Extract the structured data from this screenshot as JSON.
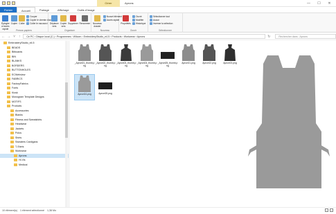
{
  "window": {
    "context_tab": "Gérer",
    "title": "Aprons",
    "minimize": "—",
    "maximize": "☐",
    "close": "✕"
  },
  "tabs": [
    "Fichier",
    "Accueil",
    "Partage",
    "Affichage",
    "Outils d'image"
  ],
  "ribbon": {
    "groups": [
      {
        "name": "Presse-papiers",
        "big": [
          "Épingler à Accès rapide",
          "Copier",
          "Coller"
        ],
        "small": [
          "Couper",
          "Copier le chemin d'accès",
          "Coller le raccourci"
        ]
      },
      {
        "name": "Organiser",
        "big": [
          "Déplacer vers",
          "Copier vers",
          "Supprimer",
          "Renommer"
        ],
        "small": []
      },
      {
        "name": "Nouveau",
        "big": [
          "Nouveau dossier"
        ],
        "small": [
          "Nouvel élément",
          "Accès rapide"
        ]
      },
      {
        "name": "Ouvrir",
        "big": [
          "Propriétés"
        ],
        "small": [
          "Ouvrir",
          "Modifier",
          "Historique"
        ]
      },
      {
        "name": "Sélectionner",
        "big": [],
        "small": [
          "Sélectionner tout",
          "Aucun",
          "Inverser la sélection"
        ]
      }
    ]
  },
  "address": {
    "path": "Ce PC  ›  Disque local (C:)  ›  Programmes  ›  Wilcom  ›  EmbroideryStudio_e4.5  ›  Products  ›  Workwear  ›  Aprons",
    "search_placeholder": "Rechercher dans : Aprons"
  },
  "sidebar": {
    "items": [
      {
        "label": "EmbroideryStudio_e4.5",
        "indent": 1
      },
      {
        "label": "BEADS",
        "indent": 2
      },
      {
        "label": "Bitboards",
        "indent": 2
      },
      {
        "label": "BIN",
        "indent": 2
      },
      {
        "label": "BLANKS",
        "indent": 2
      },
      {
        "label": "BORDERS",
        "indent": 2
      },
      {
        "label": "BUTTONHOLES",
        "indent": 2
      },
      {
        "label": "ECWebview",
        "indent": 2
      },
      {
        "label": "FABRICS",
        "indent": 2
      },
      {
        "label": "FactoryFabrics",
        "indent": 2
      },
      {
        "label": "Fonts",
        "indent": 2
      },
      {
        "label": "Kiosk",
        "indent": 2
      },
      {
        "label": "Monogram Template Designs",
        "indent": 2
      },
      {
        "label": "MOTIFS",
        "indent": 2
      },
      {
        "label": "Products",
        "indent": 2
      },
      {
        "label": "Accessories",
        "indent": 3
      },
      {
        "label": "Blanks",
        "indent": 3
      },
      {
        "label": "Fitness and Sweatshirts",
        "indent": 3
      },
      {
        "label": "Headwear",
        "indent": 3
      },
      {
        "label": "Jackets",
        "indent": 3
      },
      {
        "label": "Polos",
        "indent": 3
      },
      {
        "label": "Shirts",
        "indent": 3
      },
      {
        "label": "Sweaters Cardigans",
        "indent": 3
      },
      {
        "label": "T-Shirts",
        "indent": 3
      },
      {
        "label": "Workwear",
        "indent": 3
      },
      {
        "label": "Aprons",
        "indent": 4,
        "selected": true
      },
      {
        "label": "Hi-Vis",
        "indent": 4
      },
      {
        "label": "Medical",
        "indent": 4
      }
    ]
  },
  "files": [
    {
      "label": "_Apron01_thumb.png",
      "color": "#8d8d8d"
    },
    {
      "label": "_Apron02_thumb.png",
      "color": "#555555"
    },
    {
      "label": "_Apron03_thumb.png",
      "color": "#3a3a3a"
    },
    {
      "label": "_Apron04_thumb.png",
      "color": "#9a9a9a"
    },
    {
      "label": "_Apron05_thumb.png",
      "color": "#222222"
    },
    {
      "label": "Apron01.png",
      "color": "#8d8d8d"
    },
    {
      "label": "Apron02.png",
      "color": "#555555"
    },
    {
      "label": "Apron03.png",
      "color": "#2f2f2f"
    },
    {
      "label": "Apron04.png",
      "color": "#9a9a9a",
      "selected": true
    },
    {
      "label": "Apron05.png",
      "color": "#1e1e1e"
    }
  ],
  "status": {
    "count": "10 élément(s)",
    "selection": "1 élément sélectionné",
    "size": "1,38 Mo"
  },
  "colors": {
    "accent": "#1e70c7",
    "selection": "#cce4f7",
    "apron": "#9a9a9a"
  }
}
